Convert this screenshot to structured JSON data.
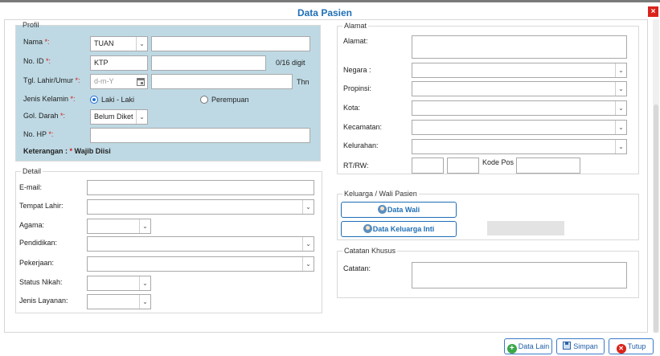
{
  "dialog": {
    "title": "Data Pasien",
    "close_glyph": "×"
  },
  "profil": {
    "legend": "Profil",
    "nama_label": "Nama",
    "nama_title": "TUAN",
    "nama_value": "",
    "noid_label": "No. ID",
    "noid_type": "KTP",
    "noid_value": "",
    "noid_counter": "0/16 digit",
    "tgl_label": "Tgl. Lahir/Umur",
    "tgl_placeholder": "d-m-Y",
    "umur_value": "",
    "umur_unit": "Thn",
    "jk_label": "Jenis Kelamin",
    "jk_options": [
      "Laki - Laki",
      "Perempuan"
    ],
    "jk_selected": "Laki - Laki",
    "goldar_label": "Gol. Darah",
    "goldar_value": "Belum Diket",
    "hp_label": "No. HP",
    "hp_value": "",
    "note_prefix": "Keterangan : ",
    "note_star": "*",
    "note_suffix": " Wajib Diisi",
    "required_mark": " *:",
    "colon": ":"
  },
  "detail": {
    "legend": "Detail",
    "email_label": "E-mail:",
    "tempat_label": "Tempat Lahir:",
    "agama_label": "Agama:",
    "pendidikan_label": "Pendidikan:",
    "pekerjaan_label": "Pekerjaan:",
    "status_label": "Status Nikah:",
    "layanan_label": "Jenis Layanan:"
  },
  "alamat": {
    "legend": "Alamat",
    "alamat_label": "Alamat:",
    "negara_label": "Negara :",
    "propinsi_label": "Propinsi:",
    "kota_label": "Kota:",
    "kecamatan_label": "Kecamatan:",
    "kelurahan_label": "Kelurahan:",
    "rtrw_label": "RT/RW:",
    "kodepos_label": "Kode Pos"
  },
  "keluarga": {
    "legend": "Keluarga / Wali Pasien",
    "wali_button": "Data Wali",
    "keluarga_button": "Data Keluarga Inti"
  },
  "catatan": {
    "legend": "Catatan Khusus",
    "catatan_label": "Catatan:"
  },
  "footer": {
    "datalain_label": "Data Lain",
    "simpan_label": "Simpan",
    "tutup_label": "Tutup"
  },
  "icons": {
    "chevron": "chevron-down-icon",
    "calendar": "calendar-icon",
    "person": "person-icon",
    "plus": "plus-circle-icon",
    "save": "save-icon",
    "close": "close-circle-icon"
  },
  "colors": {
    "title": "#1f6fb5",
    "profil_bg": "#bed9e4",
    "required": "#d21919",
    "close_red": "#d9241b"
  }
}
